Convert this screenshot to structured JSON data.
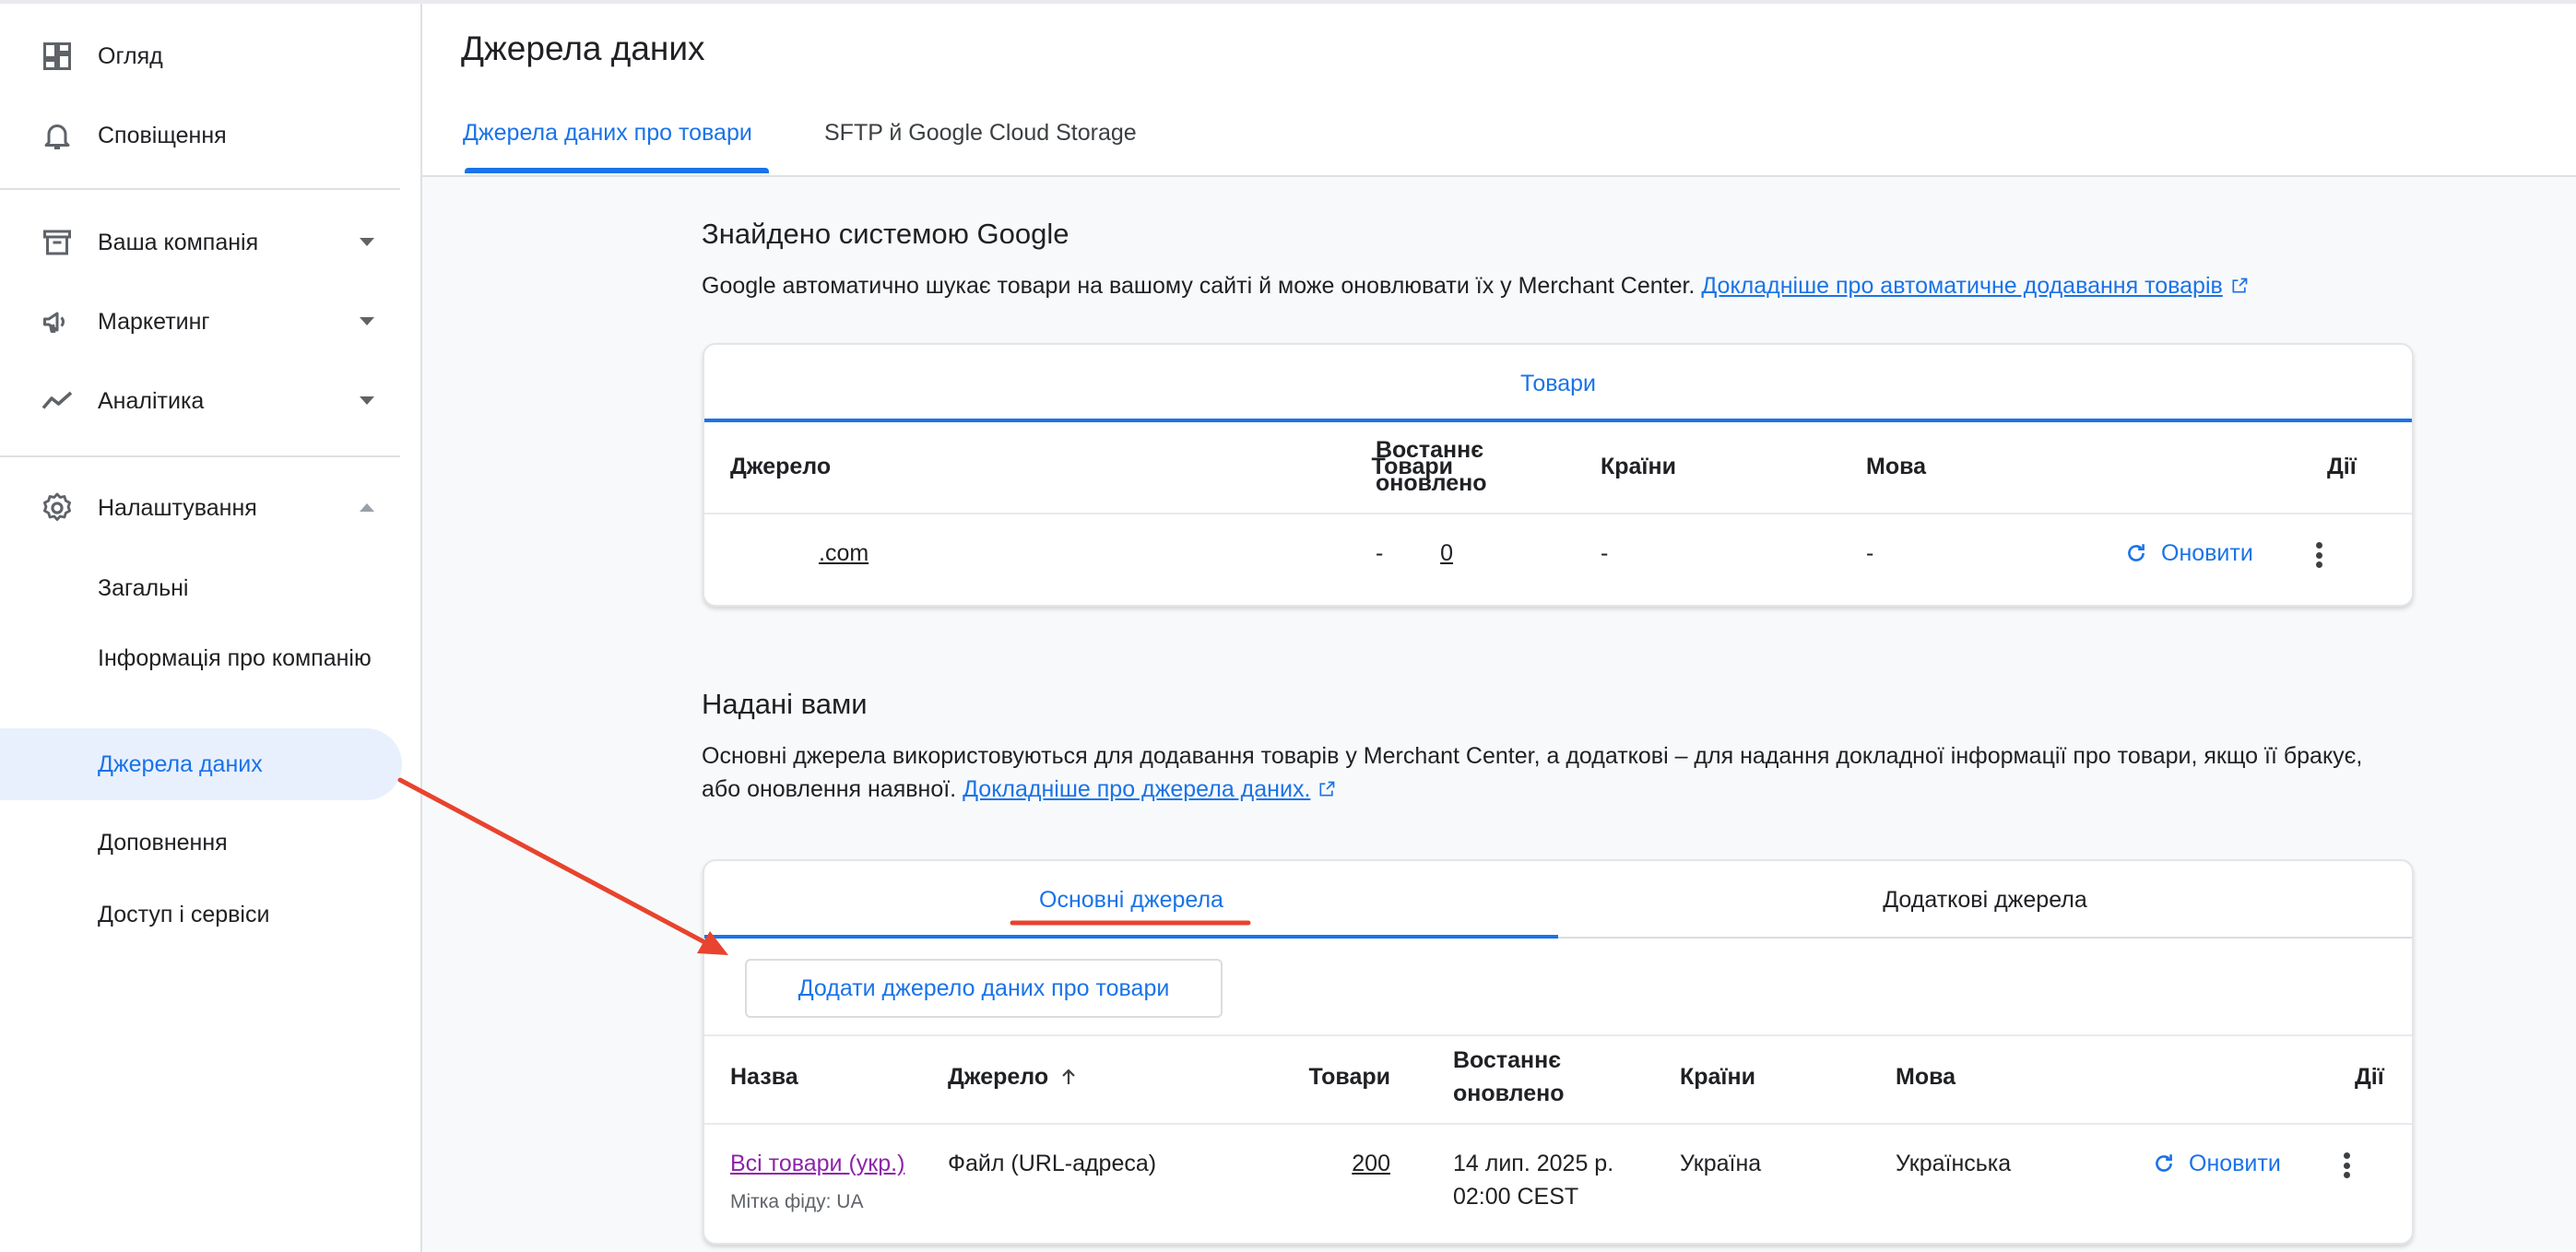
{
  "sidebar": {
    "items": [
      {
        "label": "Огляд",
        "icon": "dashboard-icon"
      },
      {
        "label": "Сповіщення",
        "icon": "bell-icon"
      },
      {
        "label": "Ваша компанія",
        "icon": "store-icon"
      },
      {
        "label": "Маркетинг",
        "icon": "megaphone-icon"
      },
      {
        "label": "Аналітика",
        "icon": "analytics-icon"
      },
      {
        "label": "Налаштування",
        "icon": "gear-icon"
      }
    ],
    "sub_items": [
      "Загальні",
      "Інформація про компанію",
      "Джерела даних",
      "Доповнення",
      "Доступ і сервіси"
    ]
  },
  "header": {
    "title": "Джерела даних",
    "tabs": [
      "Джерела даних про товари",
      "SFTP й Google Cloud Storage"
    ]
  },
  "google_section": {
    "title": "Знайдено системою Google",
    "desc": "Google автоматично шукає товари на вашому сайті й може оновлювати їх у Merchant Center.",
    "link": "Докладніше про автоматичне додавання товарів",
    "card_tab": "Товари",
    "columns": [
      "Джерело",
      "Товари",
      "Востаннє оновлено",
      "Країни",
      "Мова",
      "Дії"
    ],
    "row": {
      "source": ".com",
      "products": "0",
      "updated": "-",
      "countries": "-",
      "language": "-",
      "action": "Оновити"
    }
  },
  "user_section": {
    "title": "Надані вами",
    "desc": "Основні джерела використовуються для додавання товарів у Merchant Center, а додаткові – для надання докладної інформації про товари, якщо її бракує, або оновлення наявної.",
    "link": "Докладніше про джерела даних.",
    "tabs": [
      "Основні джерела",
      "Додаткові джерела"
    ],
    "add_button": "Додати джерело даних про товари",
    "columns": [
      "Назва",
      "Джерело",
      "Товари",
      "Востаннє оновлено",
      "Країни",
      "Мова",
      "Дії"
    ],
    "row": {
      "name": "Всі товари (укр.)",
      "feed_label": "Мітка фіду: UA",
      "source": "Файл (URL-адреса)",
      "products": "200",
      "updated": "14 лип. 2025 р. 02:00 CEST",
      "countries": "Україна",
      "language": "Українська",
      "action": "Оновити"
    }
  },
  "colors": {
    "accent": "#1a73e8",
    "annotation": "#e8432e",
    "visited_link": "#8e24aa"
  }
}
